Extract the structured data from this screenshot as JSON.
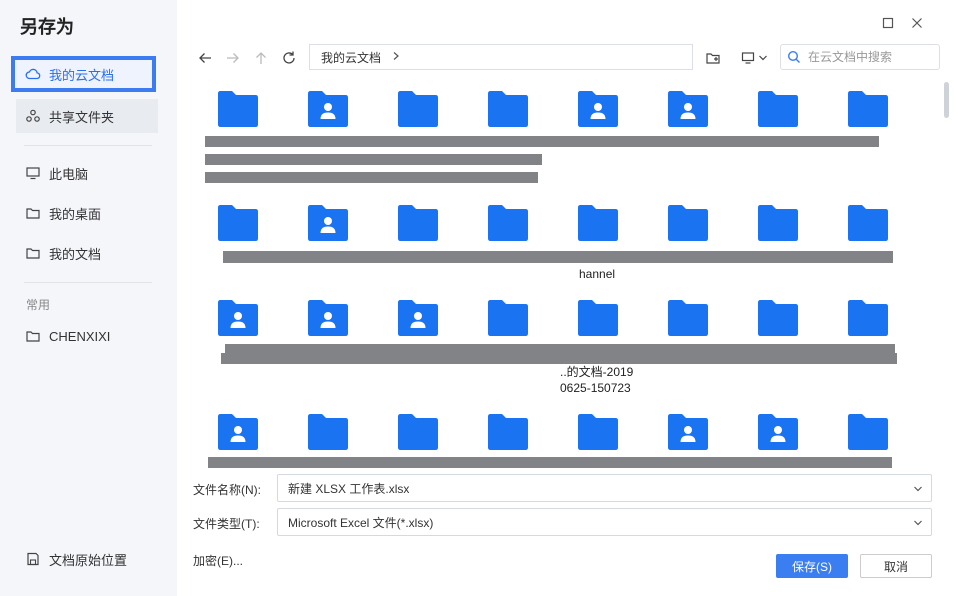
{
  "dialog": {
    "title": "另存为"
  },
  "sidebar": {
    "items": [
      {
        "label": "我的云文档"
      },
      {
        "label": "共享文件夹"
      },
      {
        "label": "此电脑"
      },
      {
        "label": "我的桌面"
      },
      {
        "label": "我的文档"
      }
    ],
    "section_label": "常用",
    "common": [
      {
        "label": "CHENXIXI"
      }
    ],
    "bottom": {
      "label": "文档原始位置"
    }
  },
  "toolbar": {
    "breadcrumb": "我的云文档",
    "search_placeholder": "在云文档中搜索"
  },
  "grid": {
    "rows": [
      {
        "icons": [
          "folder",
          "shared",
          "folder",
          "folder",
          "shared",
          "shared",
          "folder",
          "folder"
        ]
      },
      {
        "icons": [
          "folder",
          "shared",
          "folder",
          "folder",
          "folder",
          "folder",
          "folder",
          "folder"
        ]
      },
      {
        "icons": [
          "shared",
          "shared",
          "shared",
          "folder",
          "folder",
          "folder",
          "folder",
          "folder"
        ]
      },
      {
        "icons": [
          "shared",
          "folder",
          "folder",
          "folder",
          "folder",
          "shared",
          "shared",
          "folder"
        ]
      }
    ],
    "visible_texts": [
      {
        "text": "hannel"
      },
      {
        "text": "..的文档-2019"
      },
      {
        "text": "0625-150723"
      }
    ]
  },
  "fields": {
    "filename_label": "文件名称(N):",
    "filename_value": "新建 XLSX 工作表.xlsx",
    "filetype_label": "文件类型(T):",
    "filetype_value": "Microsoft Excel 文件(*.xlsx)"
  },
  "actions": {
    "encrypt_label": "加密(E)...",
    "save_label": "保存(S)",
    "cancel_label": "取消"
  },
  "colors": {
    "accent": "#3a7ef2",
    "folder": "#1a73f0",
    "redaction": "#818387"
  }
}
